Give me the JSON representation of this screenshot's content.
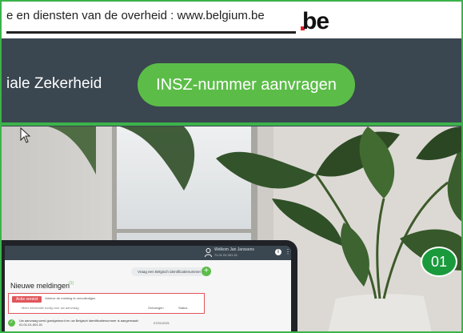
{
  "top_bar": {
    "link_text": "e en diensten van de overheid : www.belgium.be",
    "logo_text": ".be"
  },
  "header": {
    "site_title": "iale Zekerheid",
    "cta_label": "INSZ-nummer aanvragen"
  },
  "hero": {
    "step_badge": "01"
  },
  "laptop_screen": {
    "user_name": "Welkom Jan Janssens",
    "user_sub": "71 01 01 001 01",
    "info_icon": "i",
    "more_icon": "⋮",
    "ask_label": "Vraag een Belgisch identificatienummer aan",
    "ask_plus": "+",
    "title": "Nieuwe meldingen",
    "title_badge": "(1)",
    "alert": {
      "label": "Actie vereist",
      "text": "Gelieve de melding te vervolledigen",
      "sub": "Meer informatie nodig voor uw aanvraag",
      "col1": "Ontvangen",
      "col2": "Status"
    },
    "row": {
      "check": "✓",
      "text": "Uw aanvraag werd goedgekeurd en uw Belgisch identificatienummer is aangemaakt",
      "number": "01.01.01-001.01",
      "date": "07/01/2021"
    }
  },
  "colors": {
    "frame_green": "#3cb34a",
    "header_bg": "#3a4650",
    "cta_green": "#5bbd48",
    "badge_green": "#1a9a3c",
    "alert_red": "#e0565b"
  },
  "icons": [
    "be-logo",
    "cursor-icon",
    "user-icon",
    "info-icon",
    "more-icon",
    "plus-icon",
    "check-icon"
  ]
}
